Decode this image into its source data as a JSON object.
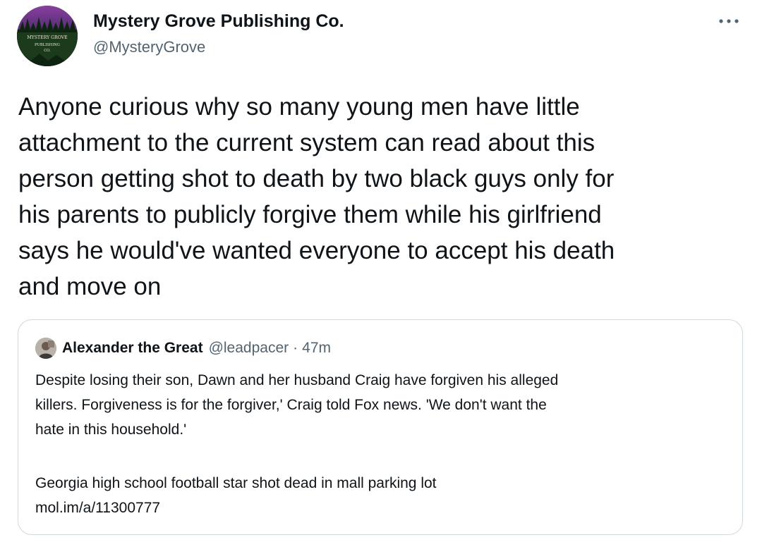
{
  "tweet": {
    "author": {
      "name": "Mystery Grove Publishing Co.",
      "handle": "@MysteryGrove",
      "avatar_icon": "mystery-grove-logo",
      "avatar_text": [
        "MYSTERY GROVE",
        "PUBLISHING",
        "CO."
      ]
    },
    "more_icon": "more-horizontal-icon",
    "text": "Anyone curious why so many young men have little\nattachment to the current system can read about this\nperson getting shot to death by two black guys only for\nhis parents to publicly forgive them while his girlfriend\nsays he would've wanted everyone to accept his death\nand move on",
    "quote": {
      "author_name": "Alexander the Great",
      "author_handle": "@leadpacer",
      "separator": "·",
      "time": "47m",
      "avatar_icon": "user-avatar",
      "text": "Despite losing their son, Dawn and her husband Craig have forgiven his alleged\nkillers. Forgiveness is for the forgiver,' Craig told Fox news. 'We don't want the\nhate in this household.'",
      "link_title": "Georgia high school football star shot dead in mall parking lot",
      "link_url": "mol.im/a/11300777"
    }
  },
  "colors": {
    "text_primary": "#0f1419",
    "text_secondary": "#536471",
    "border": "#cfd9de",
    "avatar_logo_green": "#1b3b1c"
  }
}
